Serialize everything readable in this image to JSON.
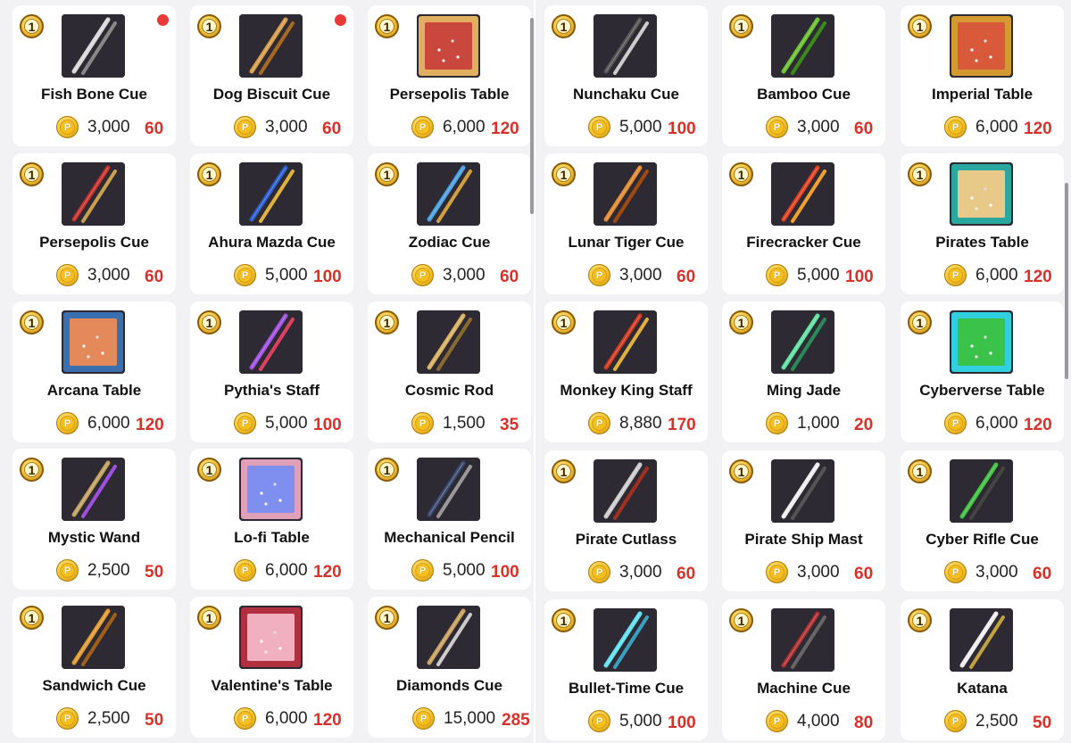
{
  "colors": {
    "accent_red": "#d8312a",
    "gold": "#f2c12c",
    "card_bg": "#ffffff",
    "page_bg": "#f2f2f4"
  },
  "badge_label": "1",
  "coin_glyph": "P",
  "left_panel": {
    "items": [
      {
        "name": "Fish Bone Cue",
        "price": "3,000",
        "sale": "60",
        "thumb": "fish-bone-cue-icon",
        "new": true
      },
      {
        "name": "Dog Biscuit Cue",
        "price": "3,000",
        "sale": "60",
        "thumb": "dog-biscuit-cue-icon",
        "new": true
      },
      {
        "name": "Persepolis Table",
        "price": "6,000",
        "sale": "120",
        "thumb": "persepolis-table-icon",
        "new": false
      },
      {
        "name": "Persepolis Cue",
        "price": "3,000",
        "sale": "60",
        "thumb": "persepolis-cue-icon",
        "new": false
      },
      {
        "name": "Ahura Mazda Cue",
        "price": "5,000",
        "sale": "100",
        "thumb": "ahura-mazda-cue-icon",
        "new": false
      },
      {
        "name": "Zodiac Cue",
        "price": "3,000",
        "sale": "60",
        "thumb": "zodiac-cue-icon",
        "new": false
      },
      {
        "name": "Arcana Table",
        "price": "6,000",
        "sale": "120",
        "thumb": "arcana-table-icon",
        "new": false
      },
      {
        "name": "Pythia's Staff",
        "price": "5,000",
        "sale": "100",
        "thumb": "pythias-staff-icon",
        "new": false
      },
      {
        "name": "Cosmic Rod",
        "price": "1,500",
        "sale": "35",
        "thumb": "cosmic-rod-icon",
        "new": false
      },
      {
        "name": "Mystic Wand",
        "price": "2,500",
        "sale": "50",
        "thumb": "mystic-wand-icon",
        "new": false
      },
      {
        "name": "Lo-fi Table",
        "price": "6,000",
        "sale": "120",
        "thumb": "lofi-table-icon",
        "new": false
      },
      {
        "name": "Mechanical Pencil",
        "price": "5,000",
        "sale": "100",
        "thumb": "mechanical-pencil-icon",
        "new": false
      },
      {
        "name": "Sandwich Cue",
        "price": "2,500",
        "sale": "50",
        "thumb": "sandwich-cue-icon",
        "new": false
      },
      {
        "name": "Valentine's Table",
        "price": "6,000",
        "sale": "120",
        "thumb": "valentines-table-icon",
        "new": false
      },
      {
        "name": "Diamonds Cue",
        "price": "15,000",
        "sale": "285",
        "thumb": "diamonds-cue-icon",
        "new": false
      }
    ]
  },
  "right_panel": {
    "items": [
      {
        "name": "Nunchaku Cue",
        "price": "5,000",
        "sale": "100",
        "thumb": "nunchaku-cue-icon",
        "new": false
      },
      {
        "name": "Bamboo Cue",
        "price": "3,000",
        "sale": "60",
        "thumb": "bamboo-cue-icon",
        "new": false
      },
      {
        "name": "Imperial Table",
        "price": "6,000",
        "sale": "120",
        "thumb": "imperial-table-icon",
        "new": false
      },
      {
        "name": "Lunar Tiger Cue",
        "price": "3,000",
        "sale": "60",
        "thumb": "lunar-tiger-cue-icon",
        "new": false
      },
      {
        "name": "Firecracker Cue",
        "price": "5,000",
        "sale": "100",
        "thumb": "firecracker-cue-icon",
        "new": false
      },
      {
        "name": "Pirates Table",
        "price": "6,000",
        "sale": "120",
        "thumb": "pirates-table-icon",
        "new": false
      },
      {
        "name": "Monkey King Staff",
        "price": "8,880",
        "sale": "170",
        "thumb": "monkey-king-staff-icon",
        "new": false
      },
      {
        "name": "Ming Jade",
        "price": "1,000",
        "sale": "20",
        "thumb": "ming-jade-icon",
        "new": false
      },
      {
        "name": "Cyberverse Table",
        "price": "6,000",
        "sale": "120",
        "thumb": "cyberverse-table-icon",
        "new": false
      },
      {
        "name": "Pirate Cutlass",
        "price": "3,000",
        "sale": "60",
        "thumb": "pirate-cutlass-icon",
        "new": false
      },
      {
        "name": "Pirate Ship Mast",
        "price": "3,000",
        "sale": "60",
        "thumb": "pirate-ship-mast-icon",
        "new": false
      },
      {
        "name": "Cyber Rifle Cue",
        "price": "3,000",
        "sale": "60",
        "thumb": "cyber-rifle-cue-icon",
        "new": false
      },
      {
        "name": "Bullet-Time Cue",
        "price": "5,000",
        "sale": "100",
        "thumb": "bullet-time-cue-icon",
        "new": false
      },
      {
        "name": "Machine Cue",
        "price": "4,000",
        "sale": "80",
        "thumb": "machine-cue-icon",
        "new": false
      },
      {
        "name": "Katana",
        "price": "2,500",
        "sale": "50",
        "thumb": "katana-icon",
        "new": false
      }
    ]
  }
}
